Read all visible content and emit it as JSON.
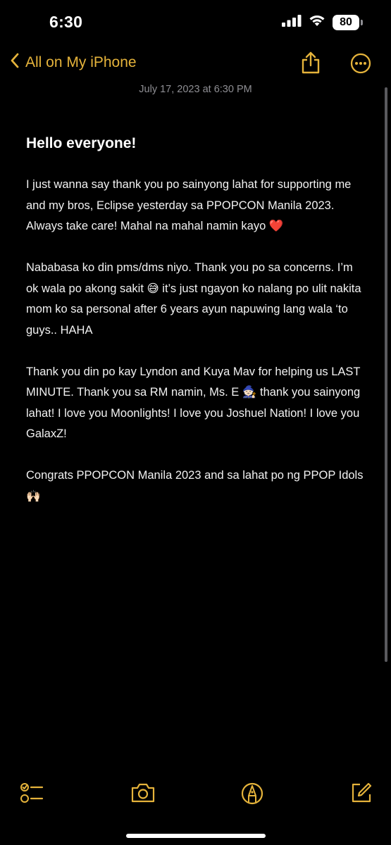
{
  "status_bar": {
    "time": "6:30",
    "battery": "80"
  },
  "nav": {
    "back_label": "All on My iPhone"
  },
  "note": {
    "date": "July 17, 2023 at 6:30 PM",
    "title": "Hello everyone!",
    "paragraphs": [
      "I just wanna say thank you po sainyong lahat for supporting me and my bros, Eclipse yesterday sa PPOPCON Manila 2023. Always take care! Mahal na mahal namin kayo ❤️",
      "Nababasa ko din pms/dms niyo. Thank you po sa concerns. I’m ok wala po akong sakit 😅 it’s just ngayon ko nalang po ulit nakita mom ko sa personal after 6 years ayun napuwing lang wala ‘to guys.. HAHA",
      "Thank you din po kay Lyndon and Kuya Mav for helping us LAST MINUTE. Thank you sa RM namin, Ms. E 🧙🏻 thank you sainyong lahat! I love you Moonlights! I love you Joshuel Nation! I love you GalaxZ!",
      "Congrats PPOPCON Manila 2023 and sa lahat po ng PPOP Idols 🙌🏻"
    ]
  },
  "colors": {
    "accent": "#e5b33b",
    "background": "#000000",
    "secondary_text": "#8e8e93"
  },
  "toolbar": {
    "icons": [
      "checklist-icon",
      "camera-icon",
      "markup-icon",
      "compose-icon"
    ]
  }
}
